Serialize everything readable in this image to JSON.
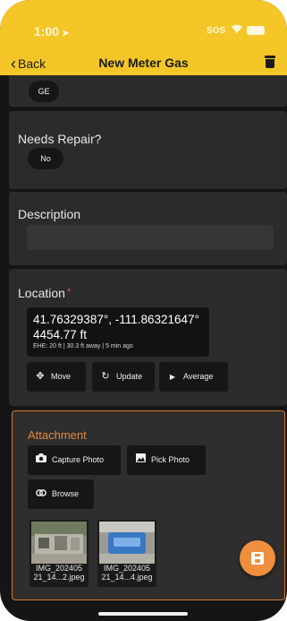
{
  "status_bar": {
    "time": "1:00",
    "sos": "SOS"
  },
  "nav": {
    "back_label": "Back",
    "title": "New Meter Gas"
  },
  "fields": {
    "manufacturer_value": "GE",
    "needs_repair": {
      "label": "Needs Repair?",
      "value": "No"
    },
    "description": {
      "label": "Description",
      "value": "",
      "placeholder": ""
    },
    "location": {
      "label": "Location",
      "required_mark": "*",
      "coordinates": "41.76329387°, -111.86321647°",
      "elevation": "4454.77 ft",
      "accuracy": "EHE: 20 ft | 30.3 ft away | 5 min ago",
      "buttons": {
        "move": "Move",
        "update": "Update",
        "average": "Average"
      }
    }
  },
  "attachment": {
    "label": "Attachment",
    "buttons": {
      "capture": "Capture Photo",
      "pick": "Pick Photo",
      "browse": "Browse"
    },
    "files": [
      {
        "line1": "IMG_202405",
        "line2": "21_14...2.jpeg"
      },
      {
        "line1": "IMG_202405",
        "line2": "21_14...4.jpeg"
      }
    ]
  },
  "icons": {
    "back": "chevron-left-icon",
    "delete": "trash-icon",
    "move": "move-arrows-icon",
    "update": "refresh-icon",
    "average": "play-icon",
    "capture": "camera-icon",
    "pick": "image-icon",
    "browse": "link-icon",
    "save": "save-icon"
  },
  "colors": {
    "header": "#f4c628",
    "accent": "#ef8f3e",
    "required": "#e05a4e",
    "background": "#151515",
    "card": "#2b2b2b"
  }
}
